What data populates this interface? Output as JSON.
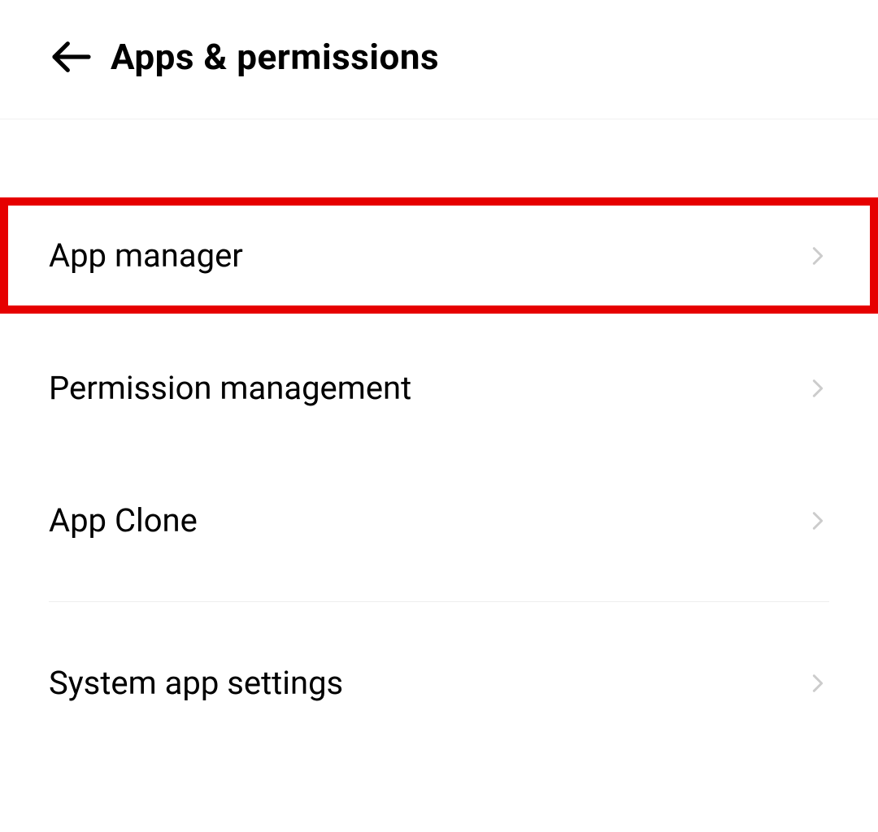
{
  "header": {
    "title": "Apps & permissions"
  },
  "menu": {
    "items": [
      {
        "label": "App manager",
        "highlighted": true
      },
      {
        "label": "Permission management",
        "highlighted": false
      },
      {
        "label": "App Clone",
        "highlighted": false
      },
      {
        "label": "System app settings",
        "highlighted": false
      }
    ]
  },
  "colors": {
    "highlight": "#e60000",
    "chevron": "#cccccc",
    "divider": "#eeeeee"
  }
}
